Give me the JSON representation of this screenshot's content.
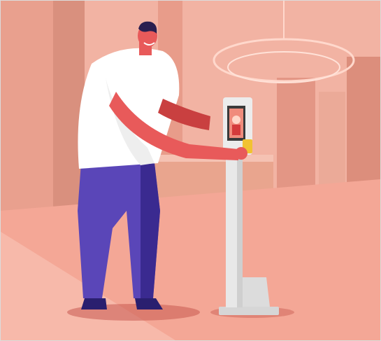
{
  "scene": {
    "colors": {
      "tint": "#f0a090",
      "floor": "#f4a796",
      "shirt": "#ffffff",
      "pants": "#5a46b8",
      "pants_shadow": "#3a2a90",
      "skin": "#e85a5a",
      "skin_dark": "#c94040",
      "hair": "#2a1f4f",
      "kiosk_body": "#e6e6e6",
      "kiosk_screen": "#3a3a3a",
      "kiosk_accent": "#f1c232",
      "shadow": "#b6473f"
    }
  }
}
